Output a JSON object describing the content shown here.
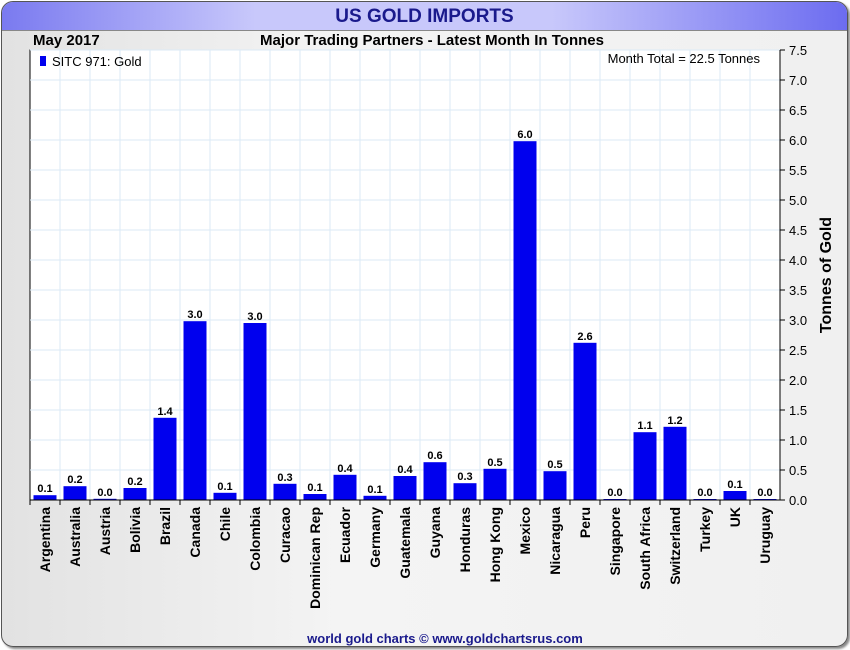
{
  "title": "US GOLD IMPORTS",
  "chart_data": {
    "type": "bar",
    "date_label": "May 2017",
    "subtitle": "Major Trading Partners - Latest Month In Tonnes",
    "legend": "SITC 971: Gold",
    "legend_position": "top-left",
    "annotation": "Month Total = 22.5 Tonnes",
    "ylabel": "Tonnes of Gold",
    "ylim": [
      0,
      7.5
    ],
    "yticks": [
      "0.0",
      "0.5",
      "1.0",
      "1.5",
      "2.0",
      "2.5",
      "3.0",
      "3.5",
      "4.0",
      "4.5",
      "5.0",
      "5.5",
      "6.0",
      "6.5",
      "7.0",
      "7.5"
    ],
    "grid": true,
    "color": "#0000ee",
    "categories": [
      "Argentina",
      "Australia",
      "Austria",
      "Bolivia",
      "Brazil",
      "Canada",
      "Chile",
      "Colombia",
      "Curacao",
      "Dominican Rep",
      "Ecuador",
      "Germany",
      "Guatemala",
      "Guyana",
      "Honduras",
      "Hong Kong",
      "Mexico",
      "Nicaragua",
      "Peru",
      "Singapore",
      "South Africa",
      "Switzerland",
      "Turkey",
      "UK",
      "Uruguay"
    ],
    "values": [
      0.08,
      0.23,
      0.02,
      0.2,
      1.37,
      2.98,
      0.12,
      2.95,
      0.27,
      0.1,
      0.42,
      0.07,
      0.4,
      0.63,
      0.28,
      0.52,
      5.98,
      0.48,
      2.62,
      0.01,
      1.13,
      1.22,
      0.01,
      0.15,
      0.0
    ],
    "labels": [
      "0.1",
      "0.2",
      "0.0",
      "0.2",
      "1.4",
      "3.0",
      "0.1",
      "3.0",
      "0.3",
      "0.1",
      "0.4",
      "0.1",
      "0.4",
      "0.6",
      "0.3",
      "0.5",
      "6.0",
      "0.5",
      "2.6",
      "0.0",
      "1.1",
      "1.2",
      "0.0",
      "0.1",
      "0.0"
    ]
  },
  "footer": "world gold charts © www.goldchartsrus.com"
}
